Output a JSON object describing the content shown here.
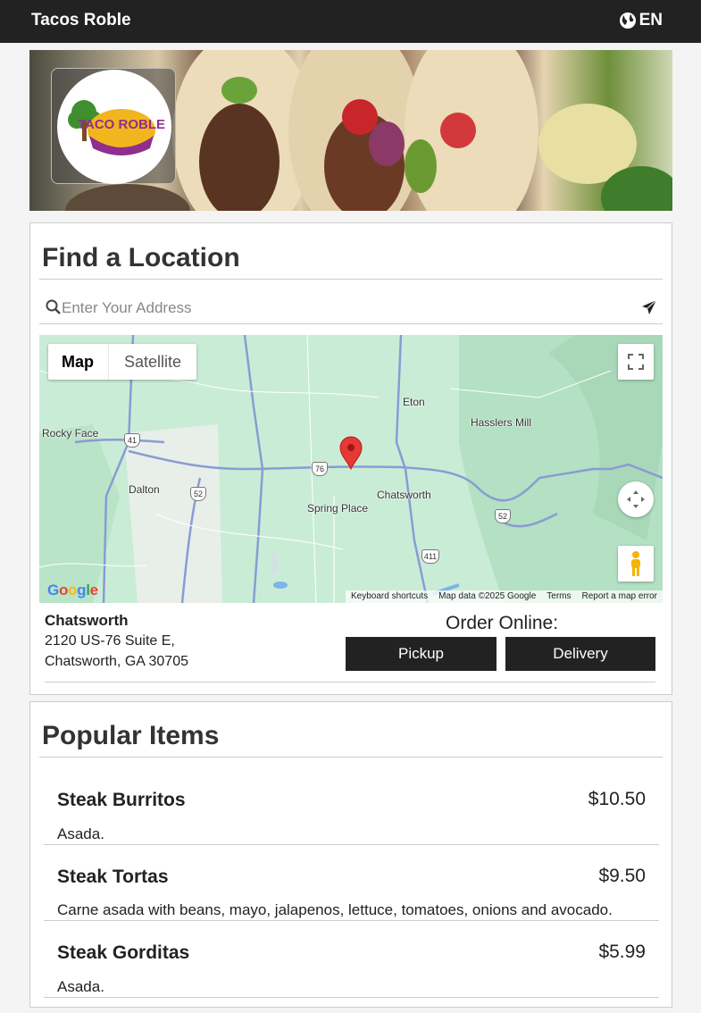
{
  "topbar": {
    "brand": "Tacos Roble",
    "language": "EN",
    "language_icon": "globe-icon"
  },
  "hero": {
    "logo_text": "TACO ROBLE"
  },
  "find_location": {
    "title": "Find a Location",
    "search": {
      "placeholder": "Enter Your Address",
      "value": "",
      "icon": "search-icon",
      "submit_icon": "paper-plane-icon"
    },
    "map": {
      "type_buttons": [
        "Map",
        "Satellite"
      ],
      "selected_type": "Map",
      "labels": [
        "Eton",
        "Hasslers Mill",
        "Rocky Face",
        "Dalton",
        "Chatsworth",
        "Spring Place"
      ],
      "route_shields": [
        "41",
        "76",
        "52",
        "52",
        "411"
      ],
      "logo": "Google",
      "attribution": [
        "Keyboard shortcuts",
        "Map data ©2025 Google",
        "Terms",
        "Report a map error"
      ],
      "colors": {
        "land": "#c9ecd7",
        "road": "#8a9bd4",
        "marker": "#e53935"
      }
    },
    "location": {
      "name": "Chatsworth",
      "address_line1": "2120 US-76 Suite E,",
      "address_line2": "Chatsworth, GA 30705"
    },
    "order": {
      "label": "Order Online:",
      "pickup": "Pickup",
      "delivery": "Delivery"
    }
  },
  "popular": {
    "title": "Popular Items",
    "items": [
      {
        "name": "Steak Burritos",
        "price": "$10.50",
        "description": "Asada."
      },
      {
        "name": "Steak Tortas",
        "price": "$9.50",
        "description": "Carne asada with beans, mayo, jalapenos, lettuce, tomatoes, onions and avocado."
      },
      {
        "name": "Steak Gorditas",
        "price": "$5.99",
        "description": "Asada."
      }
    ]
  },
  "colors": {
    "topbar": "#222222",
    "button": "#222222",
    "background": "#f4f4f4"
  }
}
